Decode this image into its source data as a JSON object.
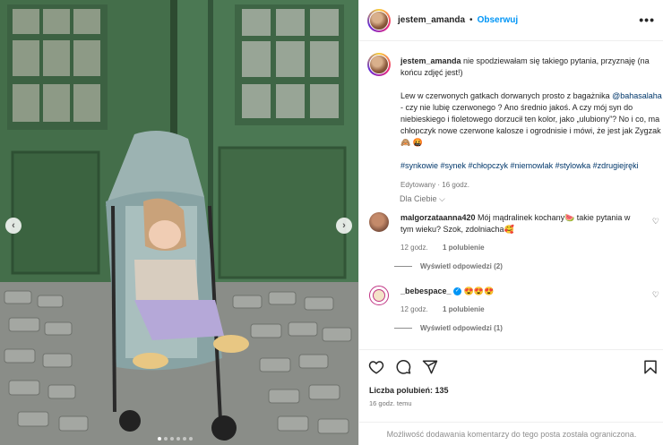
{
  "post": {
    "username": "jestem_amanda",
    "separator": "•",
    "follow_label": "Obserwuj",
    "more_icon": "more-horizontal-icon"
  },
  "caption": {
    "username": "jestem_amanda",
    "text1": " nie spodziewałam się takiego pytania, przyznaję (na końcu zdjęć jest!)",
    "text2a": "Lew w czerwonych gatkach dorwanych prosto z bagażnika ",
    "mention": "@bahasalaha",
    "text2b": " - czy nie lubię czerwonego ? Ano średnio jakoś. A czy mój syn do niebieskiego i fioletowego dorzucił ten kolor, jako „ulubiony”? No i co, ma chłopczyk nowe czerwone kalosze i ogrodnisie i mówi, że jest jak Zygzak 🙈 🤬",
    "hashtags": "#synkowie #synek #chłopczyk #niemowlak #stylowka #zdrugiejręki",
    "meta": "Edytowany · 16 godz."
  },
  "language_toggle": "Dla Ciebie ⌵",
  "comments": [
    {
      "username": "malgorzataanna420",
      "text": " Mój mądralinek kochany🍉 takie pytania w tym wieku? Szok, zdolniacha🥰",
      "time": "12 godz.",
      "likes": "1 polubienie",
      "replies": "Wyświetl odpowiedzi (2)",
      "heart_icon": "heart-outline-icon"
    },
    {
      "username": "_bebespace_",
      "verified_icon": "verified-badge-icon",
      "text": " 😍😍😍",
      "time": "12 godz.",
      "likes": "1 polubienie",
      "replies": "Wyświetl odpowiedzi (1)",
      "heart_icon": "heart-outline-icon"
    }
  ],
  "actions": {
    "like_icon": "heart-icon",
    "comment_icon": "comment-icon",
    "share_icon": "share-icon",
    "save_icon": "bookmark-icon",
    "likes_label": "Liczba polubień: 135",
    "time_label": "16 godz. temu"
  },
  "restricted_notice": "Możliwość dodawania komentarzy do tego posta została ograniczona.",
  "carousel": {
    "prev_icon": "chevron-left-icon",
    "next_icon": "chevron-right-icon",
    "slide_count": 6,
    "active_slide": 1
  },
  "colors": {
    "accent_blue": "#0095f6",
    "hashtag_blue": "#00376b",
    "muted_text": "#737373",
    "door_green": "#3f6a44"
  }
}
